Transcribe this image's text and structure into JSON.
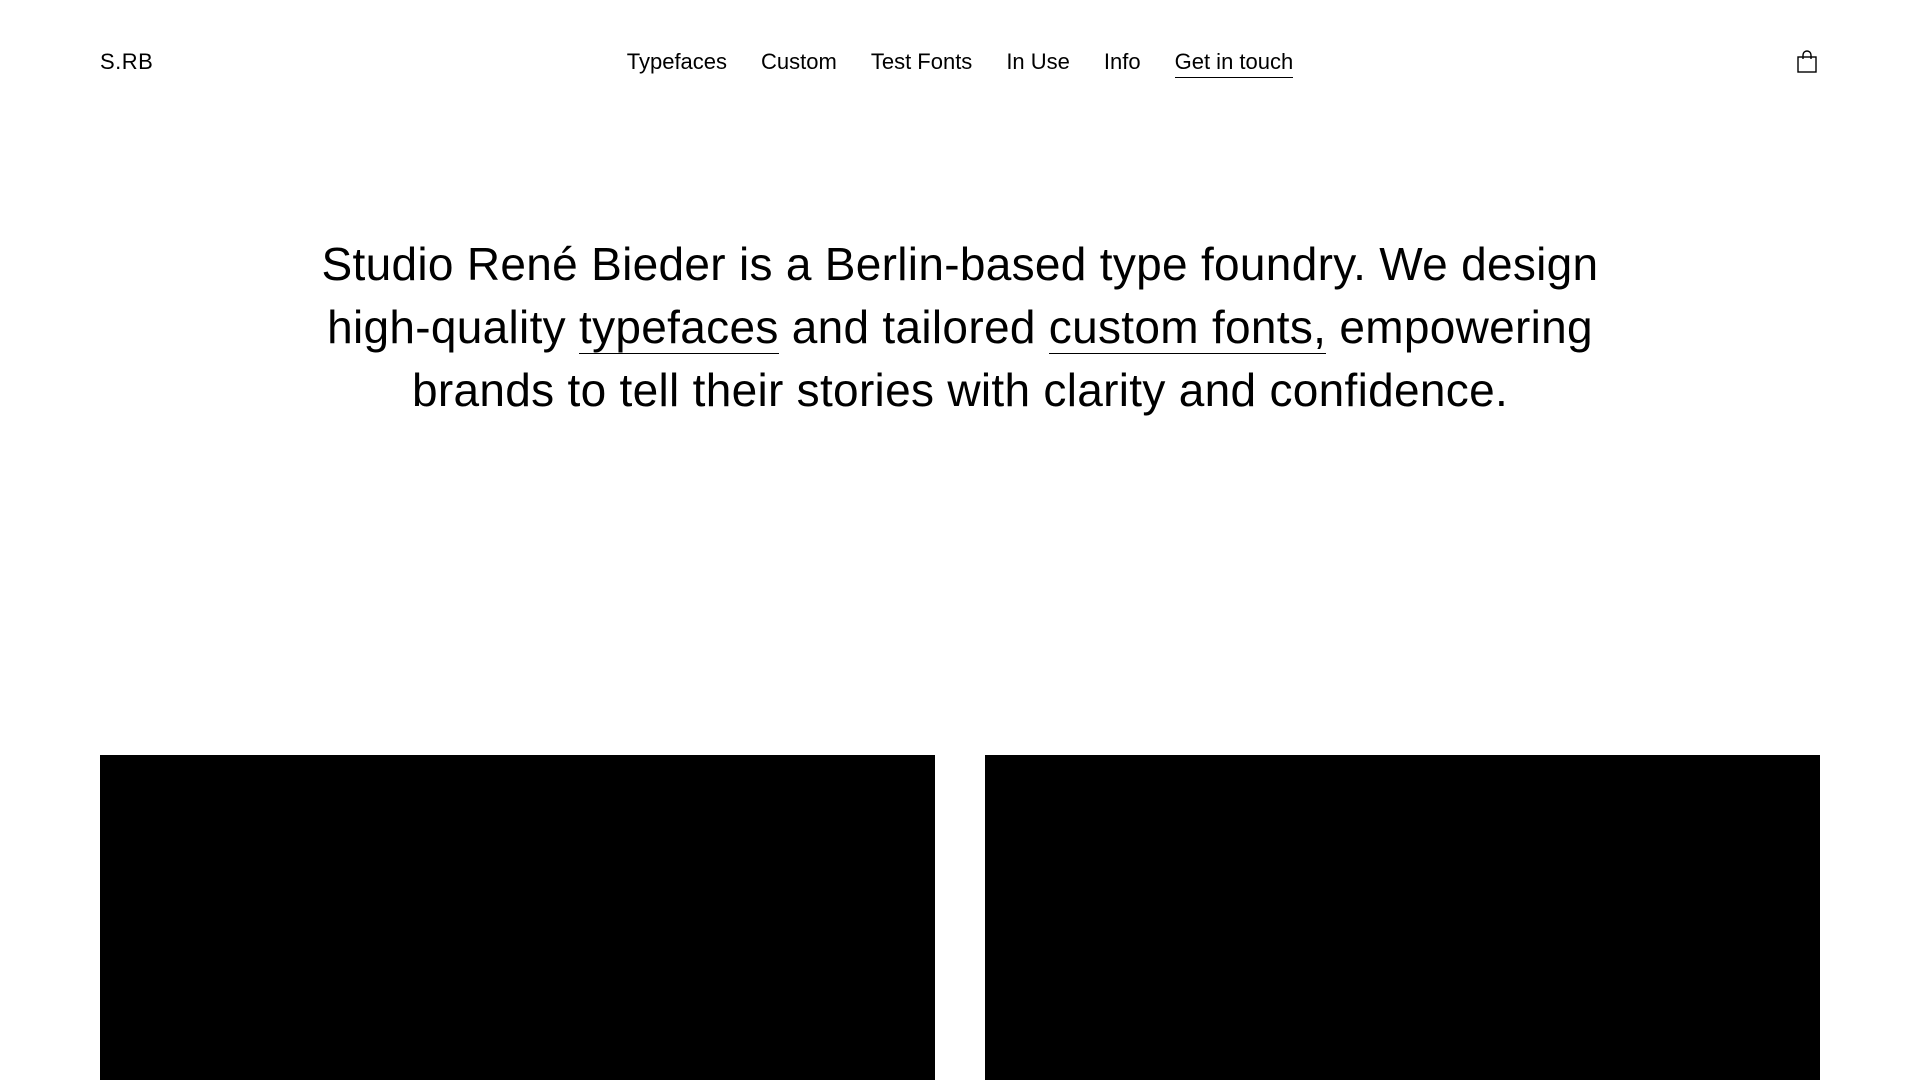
{
  "header": {
    "logo": "S.RB",
    "nav": [
      {
        "label": "Typefaces"
      },
      {
        "label": "Custom"
      },
      {
        "label": "Test Fonts"
      },
      {
        "label": "In Use"
      },
      {
        "label": "Info"
      },
      {
        "label": "Get in touch"
      }
    ],
    "cart_icon": "shopping-bag-icon"
  },
  "hero": {
    "text_1": "Studio René Bieder is a Berlin-based type foundry. We design high-quality ",
    "link_typefaces": "typefaces",
    "text_2": " and tailored ",
    "link_custom": "custom fonts,",
    "text_3": " empowering brands to tell their stories with clarity and confidence."
  },
  "colors": {
    "background": "#ffffff",
    "text": "#000000",
    "tile": "#000000"
  }
}
